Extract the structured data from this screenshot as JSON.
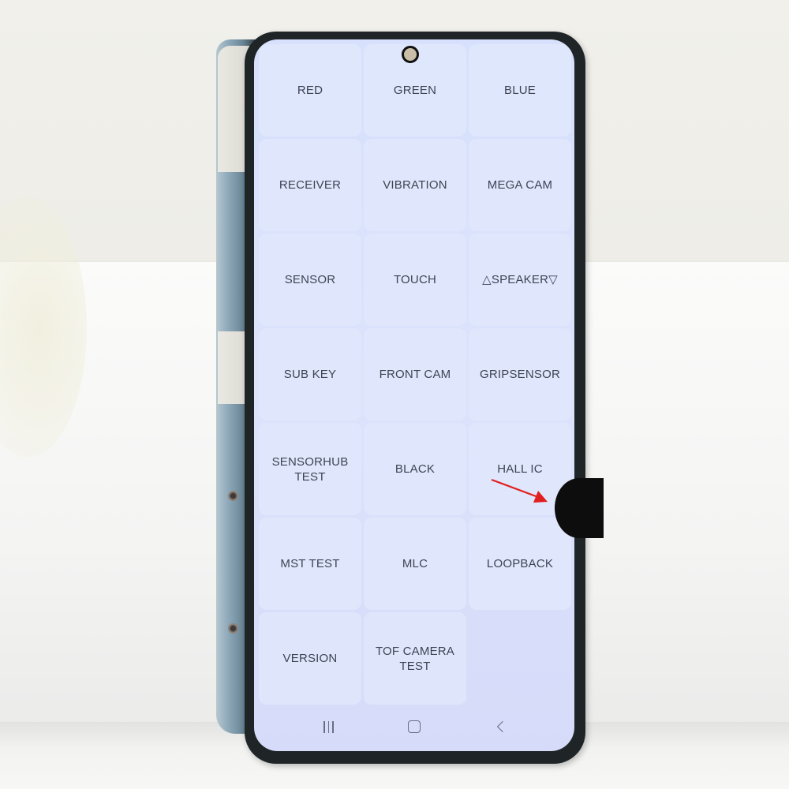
{
  "scene": {
    "description": "Photo of a smartphone display running a hardware test menu",
    "annotation": "red-arrow pointing at black spot on right edge of screen"
  },
  "test_menu": {
    "tiles": [
      {
        "label": "RED"
      },
      {
        "label": "GREEN"
      },
      {
        "label": "BLUE"
      },
      {
        "label": "RECEIVER"
      },
      {
        "label": "VIBRATION"
      },
      {
        "label": "MEGA CAM"
      },
      {
        "label": "SENSOR"
      },
      {
        "label": "TOUCH"
      },
      {
        "label": "△SPEAKER▽"
      },
      {
        "label": "SUB KEY"
      },
      {
        "label": "FRONT CAM"
      },
      {
        "label": "GRIPSENSOR"
      },
      {
        "label": "SENSORHUB\nTEST"
      },
      {
        "label": "BLACK"
      },
      {
        "label": "HALL IC"
      },
      {
        "label": "MST TEST"
      },
      {
        "label": "MLC"
      },
      {
        "label": "LOOPBACK"
      },
      {
        "label": "VERSION"
      },
      {
        "label": "TOF CAMERA\nTEST"
      }
    ]
  },
  "navbar": {
    "recent_icon": "recent-apps-icon",
    "home_icon": "home-icon",
    "back_icon": "back-icon"
  },
  "colors": {
    "screen_bg": "#d9e1fb",
    "tile_text": "#3e4354",
    "arrow": "#e02020",
    "bezel": "#1f2427"
  }
}
